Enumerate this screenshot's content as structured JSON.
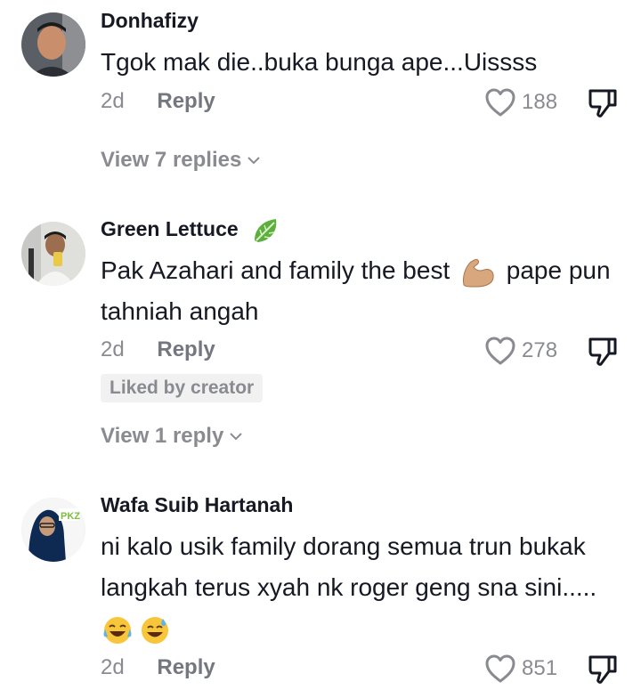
{
  "comments": [
    {
      "username": "Donhafizy",
      "text": "Tgok mak die..buka bunga ape...Uissss",
      "time": "2d",
      "reply_label": "Reply",
      "likes": "188",
      "view_replies": "View 7 replies"
    },
    {
      "username": "Green Lettuce",
      "text_part1": "Pak Azahari and family the best",
      "text_part2": "pape pun tahniah angah",
      "time": "2d",
      "reply_label": "Reply",
      "likes": "278",
      "badge": "Liked by creator",
      "view_replies": "View 1 reply"
    },
    {
      "username": "Wafa Suib Hartanah",
      "text": "ni kalo usik family dorang semua trun bukak langkah terus xyah nk roger geng sna sini.....",
      "time": "2d",
      "reply_label": "Reply",
      "likes": "851"
    }
  ],
  "icons": {
    "heart": "heart-outline-icon",
    "dislike": "thumbs-down-icon",
    "chevron": "chevron-down-icon",
    "leaf_emoji": "leafy-green-emoji",
    "muscle_emoji": "flexed-biceps-emoji",
    "laugh_emoji": "tears-of-joy-emoji",
    "sweat_emoji": "grinning-sweat-emoji"
  },
  "colors": {
    "text": "#161823",
    "muted": "#8a8b91",
    "badge_bg": "#f1f1f2"
  }
}
